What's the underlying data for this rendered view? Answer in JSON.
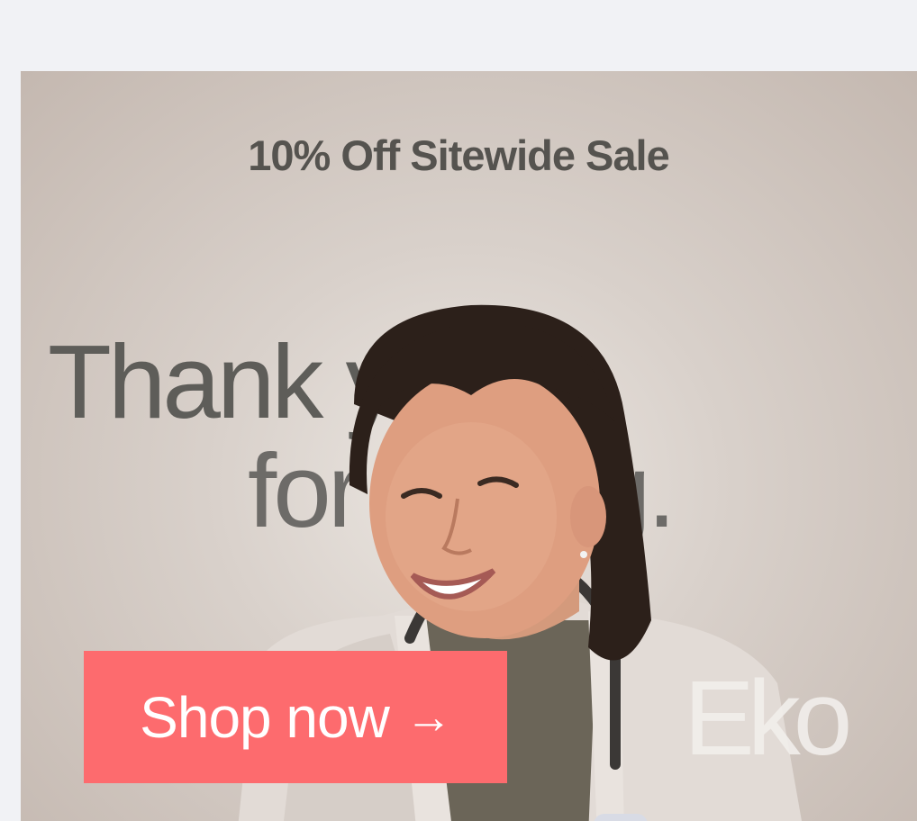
{
  "ad": {
    "sale_text": "10% Off Sitewide Sale",
    "headline_line1": "Thank you",
    "headline_line2": "for caring.",
    "cta_label": "Shop now",
    "cta_arrow": "→",
    "logo_text": "Eko",
    "colors": {
      "page_background": "#f1f2f5",
      "cta_background": "#fd6b6e",
      "cta_text": "#ffffff",
      "text_dark": "#55534f"
    },
    "icons": [
      "arrow-right-icon"
    ]
  }
}
